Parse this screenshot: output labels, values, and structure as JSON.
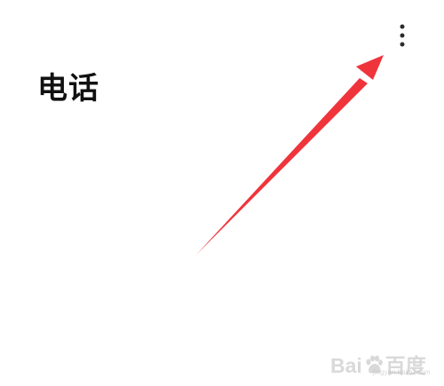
{
  "header": {
    "title": "电话",
    "more_icon": "more-vertical-icon"
  },
  "annotation": {
    "type": "arrow",
    "color": "#F0343C"
  },
  "watermark": {
    "brand_prefix": "Bai",
    "brand_suffix": "百度",
    "sub": "经验",
    "url": "jingyan.baidu.com",
    "color": "#B9B9B9"
  }
}
